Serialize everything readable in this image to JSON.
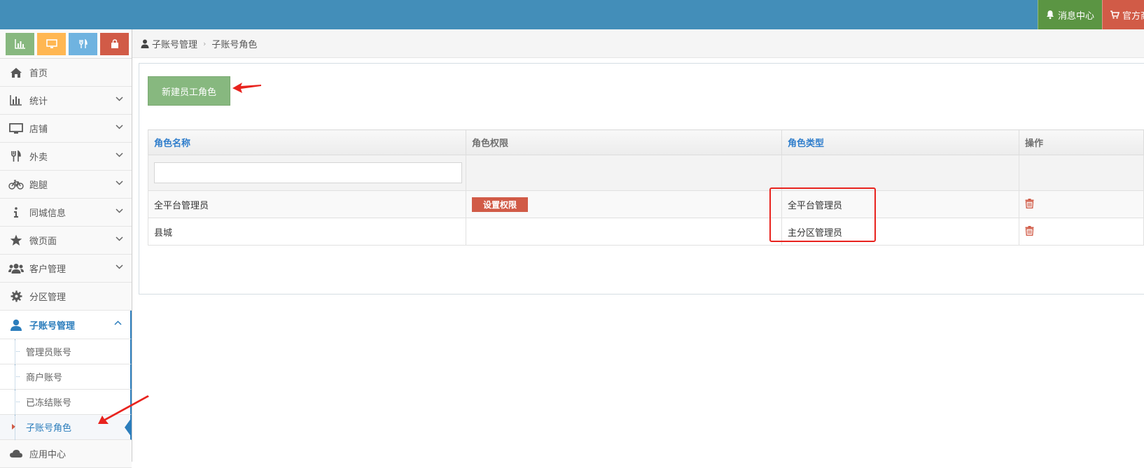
{
  "topbar": {
    "messages_label": "消息中心",
    "shop_label": "官方商城"
  },
  "sidebar": {
    "shortcuts": [
      {
        "icon": "bar-chart-icon",
        "color": "#87b87f"
      },
      {
        "icon": "desktop-icon",
        "color": "#ffb752"
      },
      {
        "icon": "cutlery-icon",
        "color": "#6fb3e0"
      },
      {
        "icon": "shopping-bag-icon",
        "color": "#d15b47"
      }
    ],
    "items": [
      {
        "label": "首页",
        "icon": "home-icon"
      },
      {
        "label": "统计",
        "icon": "bar-chart-icon"
      },
      {
        "label": "店铺",
        "icon": "desktop-icon"
      },
      {
        "label": "外卖",
        "icon": "cutlery-icon"
      },
      {
        "label": "跑腿",
        "icon": "bicycle-icon"
      },
      {
        "label": "同城信息",
        "icon": "info-icon"
      },
      {
        "label": "微页面",
        "icon": "star-icon"
      },
      {
        "label": "客户管理",
        "icon": "users-icon"
      },
      {
        "label": "分区管理",
        "icon": "gear-icon"
      },
      {
        "label": "子账号管理",
        "icon": "user-icon"
      }
    ],
    "subitems": [
      {
        "label": "管理员账号"
      },
      {
        "label": "商户账号"
      },
      {
        "label": "已冻结账号"
      },
      {
        "label": "子账号角色"
      }
    ],
    "bottom_item": {
      "label": "应用中心",
      "icon": "cloud-icon"
    }
  },
  "breadcrumb": {
    "parent": "子账号管理",
    "current": "子账号角色"
  },
  "main": {
    "new_button_label": "新建员工角色",
    "table": {
      "headers": [
        "角色名称",
        "角色权限",
        "角色类型",
        "操作"
      ],
      "rows": [
        {
          "name": "全平台管理员",
          "permission_button": "设置权限",
          "type": "全平台管理员"
        },
        {
          "name": "县城",
          "permission_button": "",
          "type": "主分区管理员"
        }
      ]
    }
  },
  "colors": {
    "topbar": "#438eb9",
    "accent": "#2b7dbc",
    "green": "#87b87f",
    "red": "#d15b47",
    "annotation": "#e8231e"
  }
}
